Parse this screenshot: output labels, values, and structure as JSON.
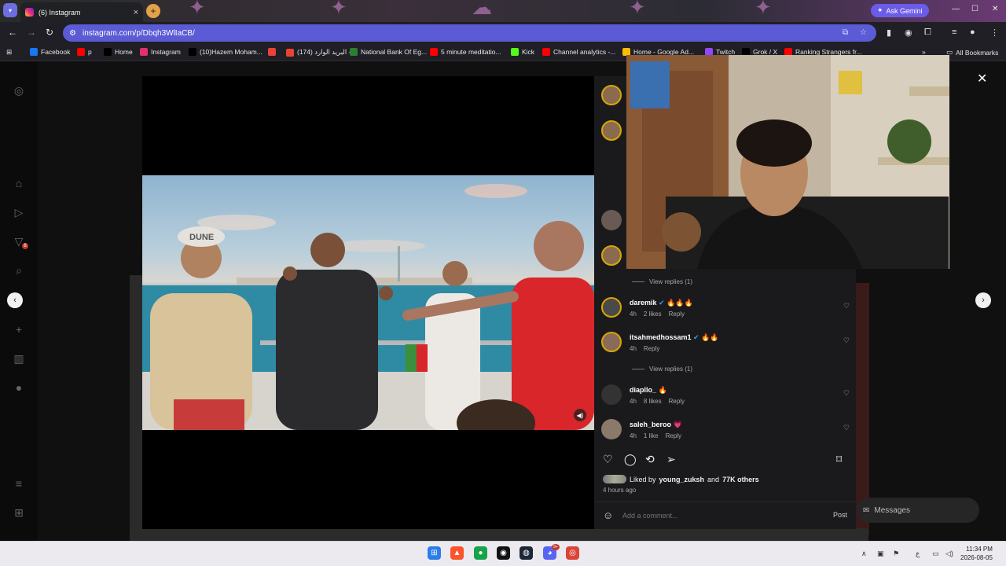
{
  "browser": {
    "tab_title": "(6) Instagram",
    "tab_close": "×",
    "new_tab": "+",
    "ask_gemini": "Ask Gemini",
    "url": "instagram.com/p/Dbqh3WlIaCB/",
    "all_bookmarks": "All Bookmarks",
    "bookmarks": [
      {
        "label": "Facebook",
        "icon": "facebook-icon",
        "color": "#1877f2"
      },
      {
        "label": "p",
        "icon": "youtube-icon",
        "color": "#ff0000"
      },
      {
        "label": "Home",
        "icon": "x-icon",
        "color": "#000000"
      },
      {
        "label": "Instagram",
        "icon": "instagram-icon",
        "color": "#e1306c"
      },
      {
        "label": "(10)Hazem Moham...",
        "icon": "tiktok-icon",
        "color": "#000000"
      },
      {
        "label": "",
        "icon": "gmail-icon",
        "color": "#ea4335"
      },
      {
        "label": "(174) البريد الوارد -...",
        "icon": "gmail-icon",
        "color": "#ea4335"
      },
      {
        "label": "National Bank Of Eg...",
        "icon": "bank-icon",
        "color": "#2e7d32"
      },
      {
        "label": "5 minute meditatio...",
        "icon": "youtube-icon",
        "color": "#ff0000"
      },
      {
        "label": "Kick",
        "icon": "kick-icon",
        "color": "#53fc18"
      },
      {
        "label": "Channel analytics -...",
        "icon": "youtube-icon",
        "color": "#ff0000"
      },
      {
        "label": "Home - Google Ad...",
        "icon": "google-ads-icon",
        "color": "#fbbc04"
      },
      {
        "label": "Twitch",
        "icon": "twitch-icon",
        "color": "#9146ff"
      },
      {
        "label": "Grok / X",
        "icon": "x-icon",
        "color": "#000000"
      },
      {
        "label": "Ranking Strangers fr...",
        "icon": "youtube-icon",
        "color": "#ff0000"
      }
    ]
  },
  "instagram": {
    "comments": [
      {
        "user": "daremik",
        "verified": true,
        "text": "🔥🔥🔥",
        "time": "4h",
        "likes": "2 likes",
        "reply": "Reply"
      },
      {
        "user": "itsahmedhossam1",
        "verified": true,
        "text": "🔥🔥",
        "time": "4h",
        "likes": "",
        "reply": "Reply"
      },
      {
        "user": "diapllo_",
        "verified": false,
        "text": "🔥",
        "time": "4h",
        "likes": "8 likes",
        "reply": "Reply"
      },
      {
        "user": "saleh_beroo",
        "verified": false,
        "text": "💗",
        "time": "4h",
        "likes": "1 like",
        "reply": "Reply"
      }
    ],
    "view_replies": "View replies (1)",
    "liked_prefix": "Liked by",
    "liked_user": "young_zuksh",
    "liked_and": "and",
    "liked_others": "77K others",
    "time_ago": "4 hours ago",
    "add_comment_placeholder": "Add a comment...",
    "post_button": "Post",
    "messages": "Messages",
    "notification_badge": "6"
  },
  "video": {
    "cap_text": "DUNE"
  },
  "taskbar": {
    "time": "11:34 PM",
    "date": "2026-08-05",
    "lang": "ع",
    "discord_badge": "9+"
  }
}
